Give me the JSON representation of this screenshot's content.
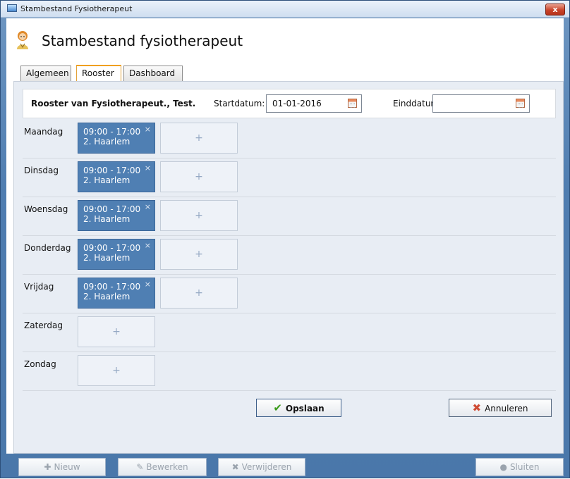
{
  "window": {
    "title": "Stambestand Fysiotherapeut",
    "close_label": "x"
  },
  "header": {
    "title": "Stambestand fysiotherapeut"
  },
  "tabs": [
    {
      "label": "Algemeen",
      "active": false
    },
    {
      "label": "Rooster",
      "active": true
    },
    {
      "label": "Dashboard",
      "active": false
    }
  ],
  "roster": {
    "title": "Rooster van Fysiotherapeut., Test.",
    "start_label": "Startdatum:",
    "start_value": "01-01-2016",
    "end_label": "Einddatum:",
    "end_value": ""
  },
  "days": [
    {
      "label": "Maandag",
      "slots": [
        {
          "time": "09:00 - 17:00",
          "location": "2. Haarlem"
        }
      ]
    },
    {
      "label": "Dinsdag",
      "slots": [
        {
          "time": "09:00 - 17:00",
          "location": "2. Haarlem"
        }
      ]
    },
    {
      "label": "Woensdag",
      "slots": [
        {
          "time": "09:00 - 17:00",
          "location": "2. Haarlem"
        }
      ]
    },
    {
      "label": "Donderdag",
      "slots": [
        {
          "time": "09:00 - 17:00",
          "location": "2. Haarlem"
        }
      ]
    },
    {
      "label": "Vrijdag",
      "slots": [
        {
          "time": "09:00 - 17:00",
          "location": "2. Haarlem"
        }
      ]
    },
    {
      "label": "Zaterdag",
      "slots": []
    },
    {
      "label": "Zondag",
      "slots": []
    }
  ],
  "slot_remove_symbol": "×",
  "add_symbol": "+",
  "actions": {
    "save_label": "Opslaan",
    "cancel_label": "Annuleren"
  },
  "toolbar": {
    "new_label": "Nieuw",
    "edit_label": "Bewerken",
    "delete_label": "Verwijderen",
    "close_label": "Sluiten"
  },
  "colors": {
    "slot_fill": "#4f7fb3",
    "window_frame": "#4f7db0",
    "active_tab_accent": "#f0a020",
    "save_icon": "#3a9b1b",
    "cancel_icon": "#cf4b34"
  },
  "icons": {
    "app": "window-icon",
    "avatar": "therapist-avatar-icon",
    "calendar": "calendar-icon",
    "save": "checkmark-icon",
    "cancel": "red-x-icon",
    "new": "plus-icon",
    "edit": "pencil-icon",
    "delete": "x-icon",
    "close": "circle-icon"
  }
}
